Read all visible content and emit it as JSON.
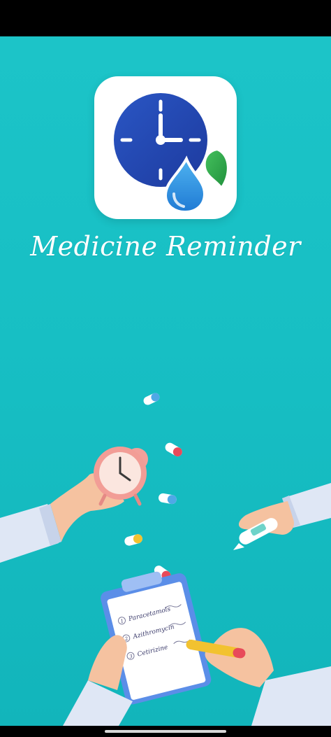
{
  "app": {
    "title": "Medicine Reminder",
    "icon": "clock-with-drop-and-leaf-icon"
  },
  "illustration": {
    "name": "hands-with-alarm-clock-pills-thermometer-and-checklist",
    "checklist_items": [
      "Paracetamols",
      "Azithromycin",
      "Cetirizine"
    ],
    "checklist_numbers": [
      "1",
      "2",
      "3"
    ]
  },
  "colors": {
    "background": "#17bfc4",
    "icon_clock_blue": "#2447b0",
    "icon_drop_blue": "#2c8de0",
    "icon_leaf_green": "#2ea84a",
    "alarm_clock_pink": "#f2a09a",
    "clipboard_blue": "#5b8ee8"
  }
}
